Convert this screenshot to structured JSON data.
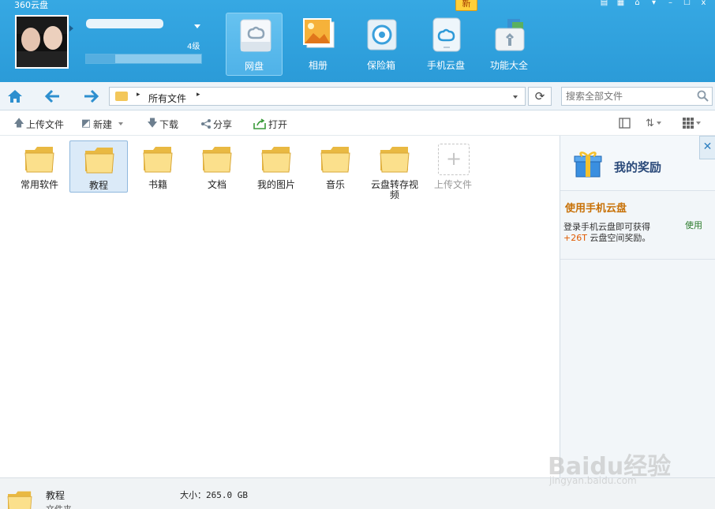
{
  "app": {
    "title": "360云盘"
  },
  "window_controls": [
    {
      "name": "menu-icon",
      "glyph": "▤"
    },
    {
      "name": "skin-icon",
      "glyph": "▦"
    },
    {
      "name": "home-mini-icon",
      "glyph": "⌂"
    },
    {
      "name": "dropdown-icon",
      "glyph": "▾"
    },
    {
      "name": "minimize-icon",
      "glyph": "–"
    },
    {
      "name": "maximize-icon",
      "glyph": "☐"
    },
    {
      "name": "close-window-icon",
      "glyph": "x"
    }
  ],
  "user": {
    "level": "4级",
    "progress": 0.25
  },
  "nav_tabs": [
    {
      "id": "wangpan",
      "label": "网盘",
      "active": true,
      "icon": "cloud-drive-icon"
    },
    {
      "id": "xiangce",
      "label": "相册",
      "active": false,
      "icon": "photo-album-icon"
    },
    {
      "id": "baoxianxiang",
      "label": "保险箱",
      "active": false,
      "icon": "safe-box-icon"
    },
    {
      "id": "shouji",
      "label": "手机云盘",
      "active": false,
      "icon": "mobile-cloud-icon"
    },
    {
      "id": "gongneng",
      "label": "功能大全",
      "active": false,
      "icon": "toolbox-icon"
    }
  ],
  "new_badge": "新",
  "address": {
    "path": "所有文件",
    "search_placeholder": "搜索全部文件"
  },
  "toolbar": {
    "upload": "上传文件",
    "new": "新建",
    "download": "下载",
    "share": "分享",
    "open": "打开"
  },
  "files": [
    {
      "name": "常用软件",
      "selected": false
    },
    {
      "name": "教程",
      "selected": true
    },
    {
      "name": "书籍",
      "selected": false
    },
    {
      "name": "文档",
      "selected": false
    },
    {
      "name": "我的图片",
      "selected": false
    },
    {
      "name": "音乐",
      "selected": false
    },
    {
      "name": "云盘转存视频",
      "selected": false
    }
  ],
  "upload_tile_label": "上传文件",
  "side_panel": {
    "title": "我的奖励",
    "reward_title": "使用手机云盘",
    "reward_desc_1": "登录手机云盘即可获得",
    "reward_highlight": "+26T",
    "reward_desc_2": " 云盘空间奖励。",
    "reward_action": "使用"
  },
  "status": {
    "name": "教程",
    "type": "文件夹",
    "size_label": "大小：265.0 GB"
  },
  "watermark": {
    "brand": "Baidu经验",
    "url": "jingyan.baidu.com"
  },
  "colors": {
    "header": "#2b9bd8",
    "accent": "#2d8fcf",
    "reward": "#c87107"
  }
}
